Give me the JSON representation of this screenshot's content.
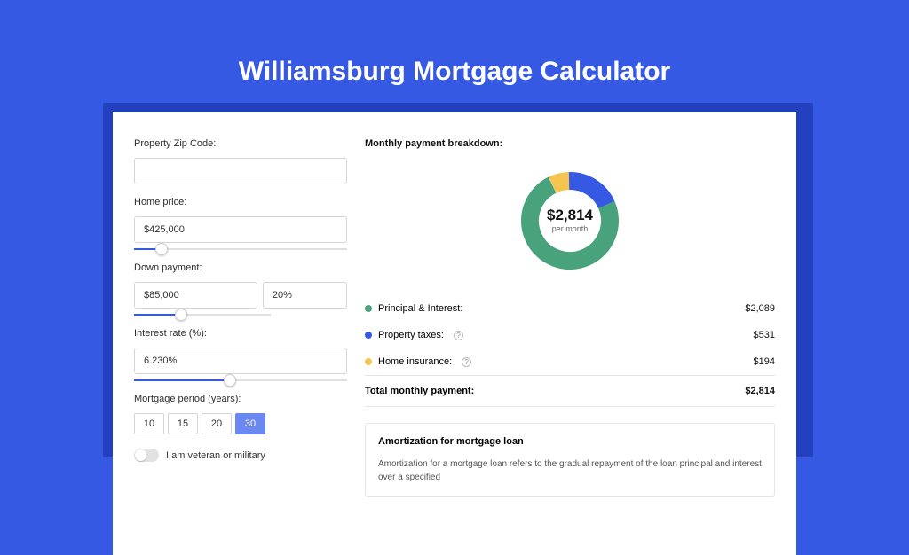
{
  "title": "Williamsburg Mortgage Calculator",
  "form": {
    "zip_label": "Property Zip Code:",
    "zip_value": "",
    "home_price_label": "Home price:",
    "home_price": "$425,000",
    "down_payment_label": "Down payment:",
    "down_payment_amount": "$85,000",
    "down_payment_pct": "20%",
    "interest_label": "Interest rate (%):",
    "interest_value": "6.230%",
    "period_label": "Mortgage period (years):",
    "period_options": [
      "10",
      "15",
      "20",
      "30"
    ],
    "period_selected": "30",
    "veteran_label": "I am veteran or military",
    "slider_home_pct": 10,
    "slider_down_pct": 30,
    "slider_interest_pct": 42
  },
  "breakdown": {
    "title": "Monthly payment breakdown:",
    "center_amount": "$2,814",
    "center_label": "per month",
    "items": [
      {
        "label": "Principal & Interest:",
        "value": "$2,089",
        "color": "green"
      },
      {
        "label": "Property taxes:",
        "value": "$531",
        "color": "blue",
        "help": true
      },
      {
        "label": "Home insurance:",
        "value": "$194",
        "color": "yellow",
        "help": true
      }
    ],
    "total_label": "Total monthly payment:",
    "total_value": "$2,814"
  },
  "amort": {
    "title": "Amortization for mortgage loan",
    "text": "Amortization for a mortgage loan refers to the gradual repayment of the loan principal and interest over a specified"
  },
  "chart_data": {
    "type": "pie",
    "title": "Monthly payment breakdown",
    "series": [
      {
        "name": "Principal & Interest",
        "value": 2089,
        "color": "#48a37c"
      },
      {
        "name": "Property taxes",
        "value": 531,
        "color": "#3659e3"
      },
      {
        "name": "Home insurance",
        "value": 194,
        "color": "#f5c451"
      }
    ],
    "total": 2814,
    "center_label": "$2,814 per month"
  }
}
